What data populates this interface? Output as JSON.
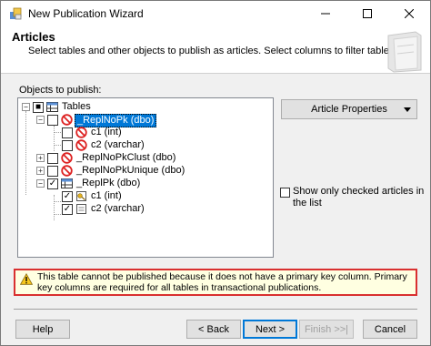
{
  "window": {
    "title": "New Publication Wizard"
  },
  "header": {
    "title": "Articles",
    "subtitle": "Select tables and other objects to publish as articles. Select columns to filter tables."
  },
  "objects_label": "Objects to publish:",
  "tree": {
    "root": "Tables",
    "items": [
      {
        "label": "_ReplNoPk (dbo)",
        "selected": true,
        "checked": false,
        "icon": "no-entry-icon"
      },
      {
        "label": "c1 (int)",
        "checked": false,
        "icon": "no-entry-icon"
      },
      {
        "label": "c2 (varchar)",
        "checked": false,
        "icon": "no-entry-icon"
      },
      {
        "label": "_ReplNoPkClust (dbo)",
        "checked": false,
        "icon": "no-entry-icon"
      },
      {
        "label": "_ReplNoPkUnique (dbo)",
        "checked": false,
        "icon": "no-entry-icon"
      },
      {
        "label": "_ReplPk (dbo)",
        "checked": true,
        "icon": "table-icon"
      },
      {
        "label": "c1 (int)",
        "checked": true,
        "icon": "key-column-icon"
      },
      {
        "label": "c2 (varchar)",
        "checked": true,
        "icon": "column-icon"
      }
    ]
  },
  "article_properties_label": "Article Properties",
  "show_only_checked": {
    "label": "Show only checked articles in the list",
    "checked": false
  },
  "warning": {
    "text": "This table cannot be published because it does not have a primary key column. Primary key columns are required for all tables in transactional publications."
  },
  "buttons": {
    "help": "Help",
    "back": "< Back",
    "next": "Next >",
    "finish": "Finish >>|",
    "cancel": "Cancel"
  },
  "colors": {
    "selection": "#0078d7",
    "warning_border": "#d93030",
    "warning_bg": "#ffffe1"
  }
}
